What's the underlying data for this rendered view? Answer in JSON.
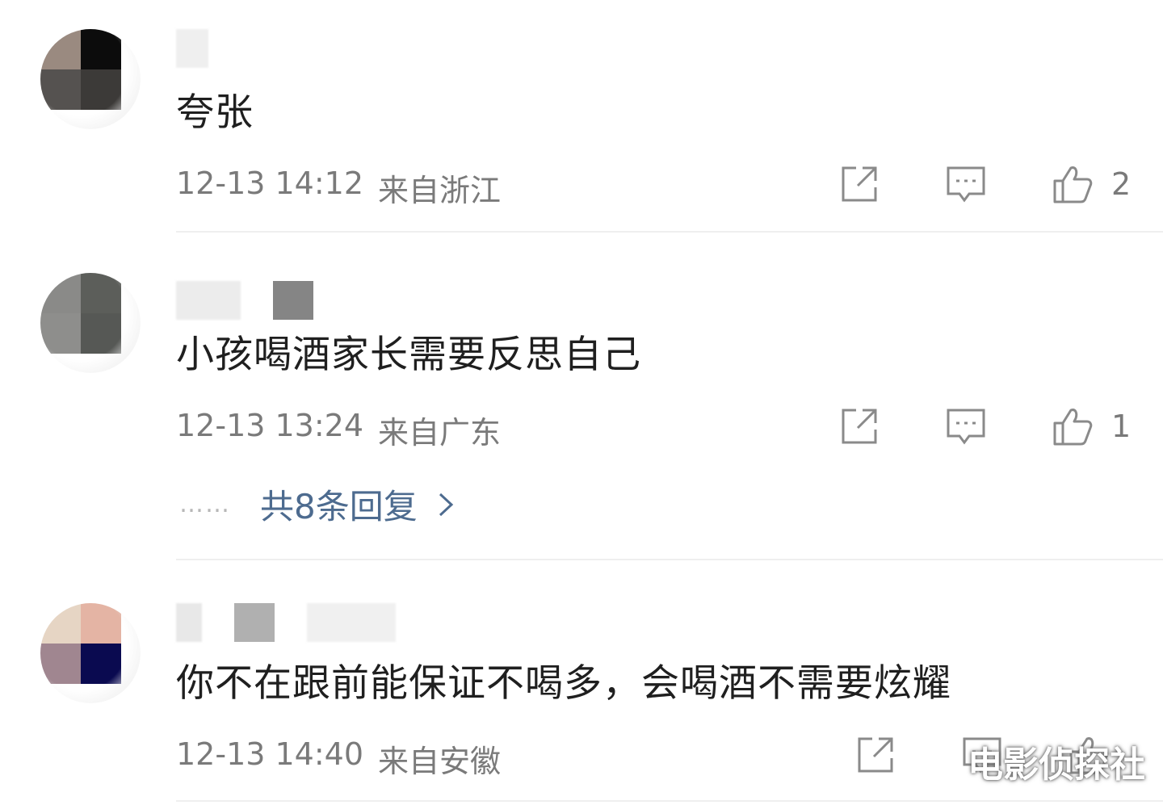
{
  "comments": [
    {
      "avatar_colors": [
        "#9a8a80",
        "#0c0c0c",
        "#555250",
        "#3c3a38"
      ],
      "text": "夸张",
      "time": "12-13 14:12",
      "location": "来自浙江",
      "likes": "2"
    },
    {
      "avatar_colors": [
        "#8a8a88",
        "#5c5e5a",
        "#8e8e8c",
        "#565855"
      ],
      "text": "小孩喝酒家长需要反思自己",
      "time": "12-13 13:24",
      "location": "来自广东",
      "likes": "1",
      "replies_label": "共8条回复",
      "replies_dots": "……"
    },
    {
      "avatar_colors": [
        "#e6d5c4",
        "#e4b4a4",
        "#a08690",
        "#0a0a50"
      ],
      "text": "你不在跟前能保证不喝多，会喝酒不需要炫耀",
      "time": "12-13 14:40",
      "location": "来自安徽"
    }
  ],
  "icons": {
    "share": "share-icon",
    "comment": "comment-icon",
    "like": "thumbs-up-icon",
    "chevron": "chevron-right-icon"
  },
  "watermark": "电影侦探社",
  "colors": {
    "content_text": "#1f1f1f",
    "meta_text": "#7a7a7a",
    "link": "#4d6b8f",
    "icon": "#8a8a8a",
    "divider": "#efefef"
  }
}
